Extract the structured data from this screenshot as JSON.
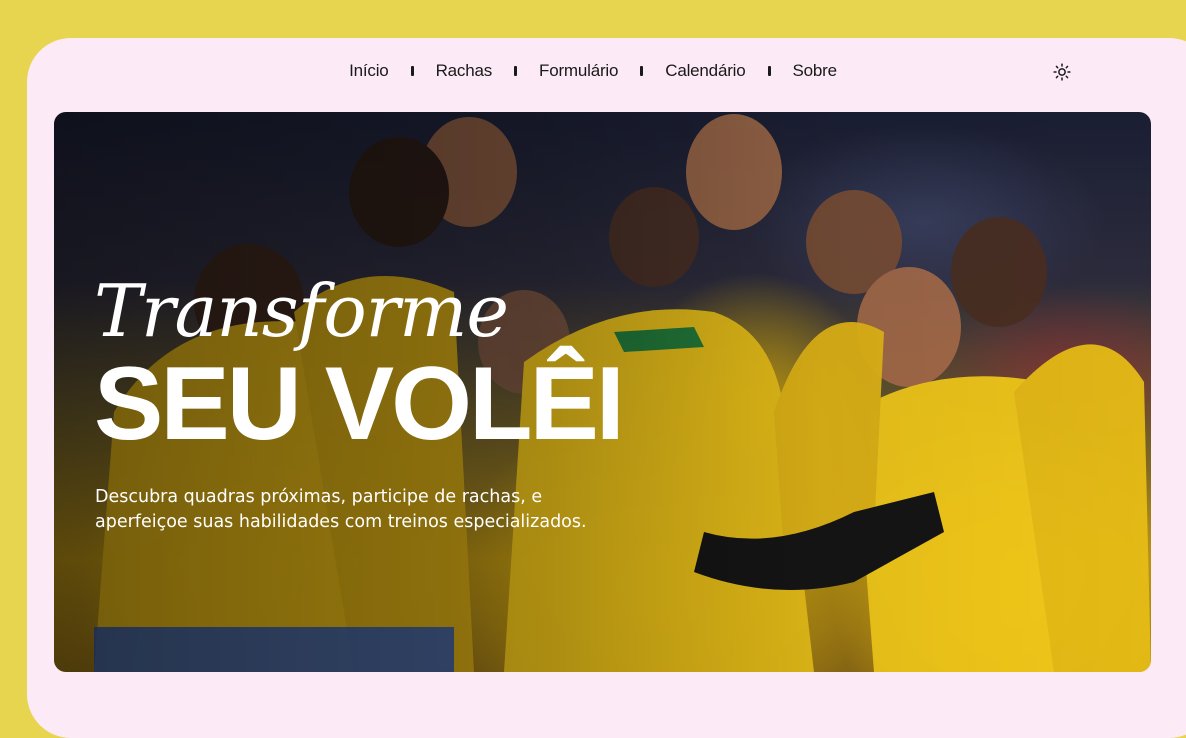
{
  "nav": {
    "items": [
      {
        "label": "Início"
      },
      {
        "label": "Rachas"
      },
      {
        "label": "Formulário"
      },
      {
        "label": "Calendário"
      },
      {
        "label": "Sobre"
      }
    ],
    "theme_icon": "sun-icon"
  },
  "hero": {
    "script_line": "Transforme",
    "title_line": "SEU VOLÊI",
    "description_line1": "Descubra quadras próximas, participe de rachas, e",
    "description_line2": "aperfeiçoe suas habilidades com treinos especializados.",
    "background_image": "photo of Brazilian volleyball team celebrating in yellow jerseys"
  },
  "colors": {
    "page_background": "#e8d54f",
    "card_background": "#fcebf6",
    "text_dark": "#1a1a1a",
    "hero_text": "#ffffff"
  }
}
